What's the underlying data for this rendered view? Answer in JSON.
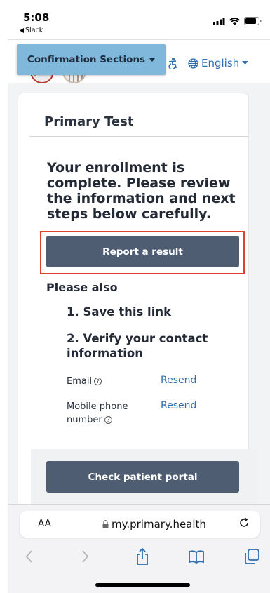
{
  "status_bar": {
    "time": "5:08",
    "back_label": "Slack"
  },
  "header": {
    "confirmation_sections_label": "Confirmation Sections",
    "language_label": "English"
  },
  "card": {
    "title": "Primary Test",
    "heading": "Your enrollment is complete. Please review the information and next steps below carefully.",
    "report_button": "Report a result",
    "please_also": "Please also",
    "step1": "1. Save this link",
    "step2": "2. Verify your contact information",
    "contact_rows": [
      {
        "label": "Email",
        "action": "Resend"
      },
      {
        "label": "Mobile phone number",
        "action": "Resend"
      }
    ],
    "portal_button": "Check patient portal"
  },
  "browser": {
    "text_size_label": "AA",
    "url": "my.primary.health"
  },
  "colors": {
    "primary_button": "#4e5d72",
    "link": "#2f6fb0",
    "confirmation_button": "#7fb8da",
    "highlight_border": "#e0412f"
  }
}
